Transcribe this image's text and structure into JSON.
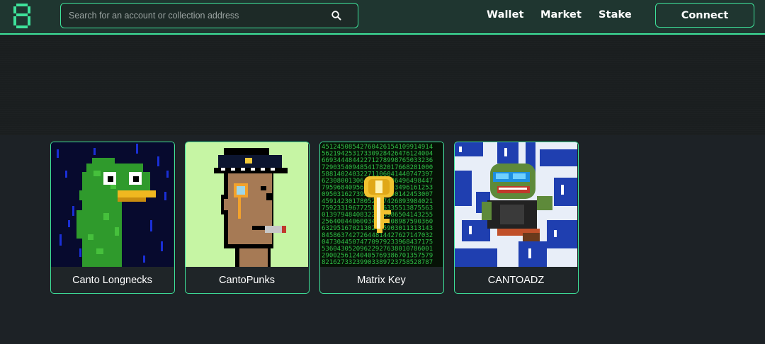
{
  "header": {
    "logo_icon": "pixel-eight-logo-icon",
    "search": {
      "placeholder": "Search for an account or collection address",
      "value": "",
      "icon": "search-icon"
    },
    "nav": [
      {
        "label": "Wallet"
      },
      {
        "label": "Market"
      },
      {
        "label": "Stake"
      }
    ],
    "connect_label": "Connect"
  },
  "collections": [
    {
      "name": "Canto Longnecks",
      "image": "green-pixel-duck-longneck"
    },
    {
      "name": "CantoPunks",
      "image": "pixel-punk-police-cap-monocle"
    },
    {
      "name": "Matrix Key",
      "image": "golden-key-on-matrix-code"
    },
    {
      "name": "CANTOADZ",
      "image": "pixel-toad-with-sunglasses"
    }
  ],
  "colors": {
    "accent": "#3ee29a",
    "header_bg": "#1f3630",
    "page_bg": "#1c2024"
  }
}
